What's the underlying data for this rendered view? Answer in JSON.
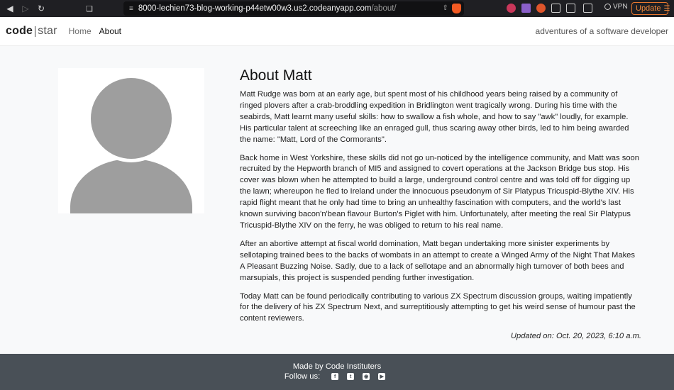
{
  "browser": {
    "url_host": "8000-lechien73-blog-working-p44etw00w3.us2.codeanyapp.com",
    "url_path": "/about/",
    "vpn_label": "VPN",
    "update_label": "Update"
  },
  "navbar": {
    "brand_code": "code",
    "brand_star": "star",
    "links": [
      {
        "label": "Home",
        "active": false
      },
      {
        "label": "About",
        "active": true
      }
    ],
    "tagline": "adventures of a software developer"
  },
  "about": {
    "title": "About Matt",
    "paragraphs": [
      "Matt Rudge was born at an early age, but spent most of his childhood years being raised by a community of ringed plovers after a crab-broddling expedition in Bridlington went tragically wrong. During his time with the seabirds, Matt learnt many useful skills: how to swallow a fish whole, and how to say \"awk\" loudly, for example. His particular talent at screeching like an enraged gull, thus scaring away other birds, led to him being awarded the name: \"Matt, Lord of the Cormorants\".",
      "Back home in West Yorkshire, these skills did not go un-noticed by the intelligence community, and Matt was soon recruited by the Hepworth branch of MI5 and assigned to covert operations at the Jackson Bridge bus stop. His cover was blown when he attempted to build a large, underground control centre and was told off for digging up the lawn; whereupon he fled to Ireland under the innocuous pseudonym of Sir Platypus Tricuspid-Blythe XIV. His rapid flight meant that he only had time to bring an unhealthy fascination with computers, and the world's last known surviving bacon'n'bean flavour Burton's Piglet with him. Unfortunately, after meeting the real Sir Platypus Tricuspid-Blythe XIV on the ferry, he was obliged to return to his real name.",
      "After an abortive attempt at fiscal world domination, Matt began undertaking more sinister experiments by sellotaping trained bees to the backs of wombats in an attempt to create a Winged Army of the Night That Makes A Pleasant Buzzing Noise. Sadly, due to a lack of sellotape and an abnormally high turnover of both bees and marsupials, this project is suspended pending further investigation.",
      "Today Matt can be found periodically contributing to various ZX Spectrum discussion groups, waiting impatiently for the delivery of his ZX Spectrum Next, and surreptitiously attempting to get his weird sense of humour past the content reviewers."
    ],
    "updated": "Updated on: Oct. 20, 2023, 6:10 a.m."
  },
  "footer": {
    "made_by": "Made by Code Instituters",
    "follow_label": "Follow us:",
    "social_icons": [
      "facebook-icon",
      "twitter-icon",
      "instagram-icon",
      "youtube-icon"
    ]
  },
  "colors": {
    "footer_bg": "#495057",
    "page_bg": "#f8f9fa",
    "avatar_gray": "#9e9e9e",
    "update_accent": "#f08a3c"
  }
}
